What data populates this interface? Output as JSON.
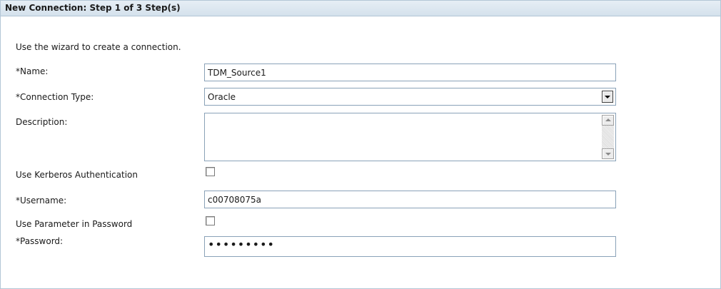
{
  "wizard": {
    "title": "New Connection: Step 1 of 3 Step(s)",
    "intro": "Use the wizard to create a connection."
  },
  "form": {
    "name": {
      "label": "*Name:",
      "value": "TDM_Source1"
    },
    "connection_type": {
      "label": "*Connection Type:",
      "value": "Oracle"
    },
    "description": {
      "label": "Description:",
      "value": ""
    },
    "kerberos": {
      "label": "Use Kerberos Authentication",
      "checked": false
    },
    "username": {
      "label": "*Username:",
      "value": "c00708075a"
    },
    "param_password": {
      "label": "Use Parameter in Password",
      "checked": false
    },
    "password": {
      "label": "*Password:",
      "masked": "•••••••••"
    }
  },
  "colors": {
    "header_bg": "#d4e1ec",
    "border": "#b3c6d6",
    "field_border": "#8aa2b8"
  }
}
